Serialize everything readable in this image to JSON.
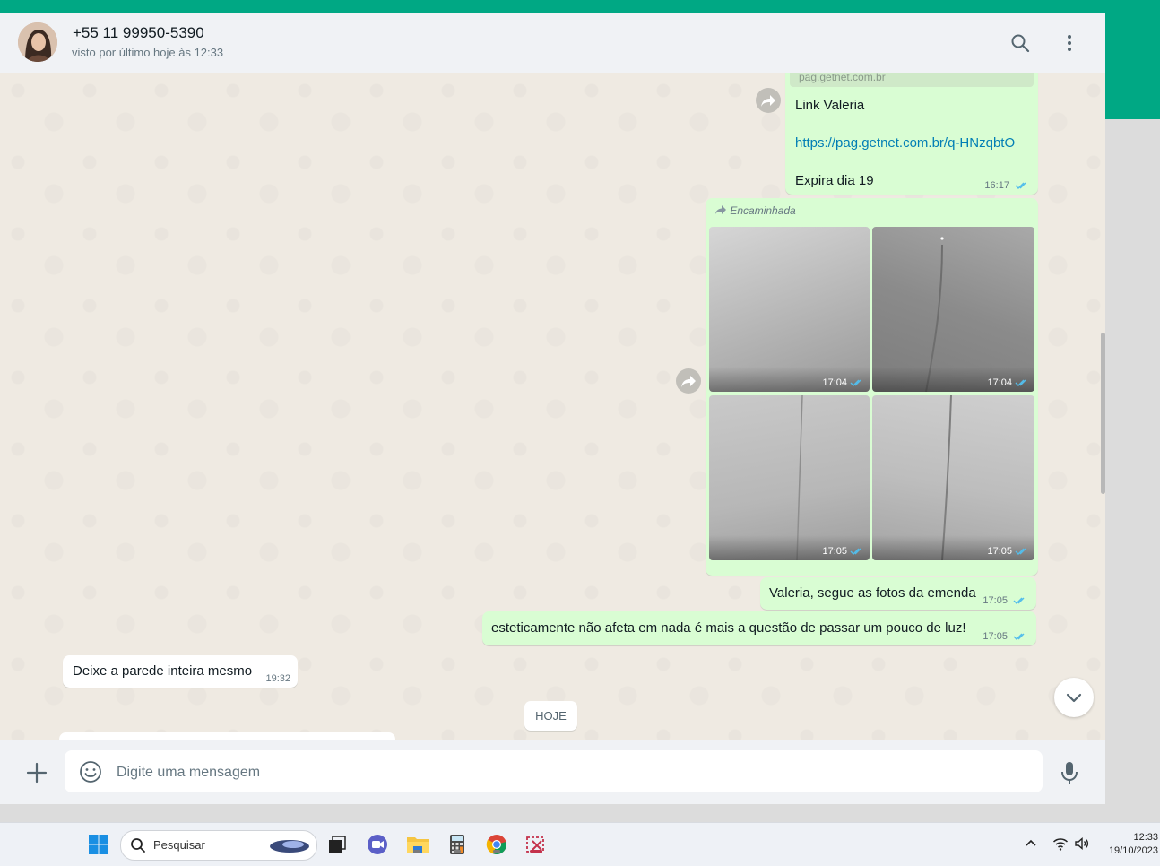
{
  "contact": {
    "name": "+55 11 99950-5390",
    "status": "visto por último hoje às 12:33"
  },
  "messages": {
    "link_preview_domain": "pag.getnet.com.br",
    "link_msg": {
      "line1": "Link Valeria",
      "url": "https://pag.getnet.com.br/q-HNzqbtO",
      "line3": "Expira dia 19",
      "time": "16:17"
    },
    "forwarded_label": "Encaminhada",
    "photos": [
      {
        "time": "17:04"
      },
      {
        "time": "17:04"
      },
      {
        "time": "17:05"
      },
      {
        "time": "17:05"
      }
    ],
    "caption": {
      "text": "Valeria, segue as fotos da emenda",
      "time": "17:05"
    },
    "msg2": {
      "text": "esteticamente não afeta em nada é mais a questão de passar um pouco de luz!",
      "time": "17:05"
    },
    "incoming": {
      "text": "Deixe a parede inteira mesmo",
      "time": "19:32"
    },
    "day_divider": "HOJE"
  },
  "composer": {
    "placeholder": "Digite uma mensagem"
  },
  "taskbar": {
    "search_label": "Pesquisar",
    "time": "12:33",
    "date": "19/10/2023"
  },
  "colors": {
    "brand_green": "#00a884",
    "outgoing_bubble": "#d9fdd3",
    "read_ticks": "#53bdeb",
    "link": "#027eb5"
  },
  "icons": [
    "search-icon",
    "menu-icon",
    "forward-icon",
    "chevron-down-icon",
    "plus-icon",
    "emoji-icon",
    "microphone-icon",
    "windows-start-icon",
    "task-view-icon",
    "teams-icon",
    "file-explorer-icon",
    "calculator-icon",
    "chrome-icon",
    "snipping-tool-icon",
    "wifi-icon",
    "volume-icon"
  ]
}
